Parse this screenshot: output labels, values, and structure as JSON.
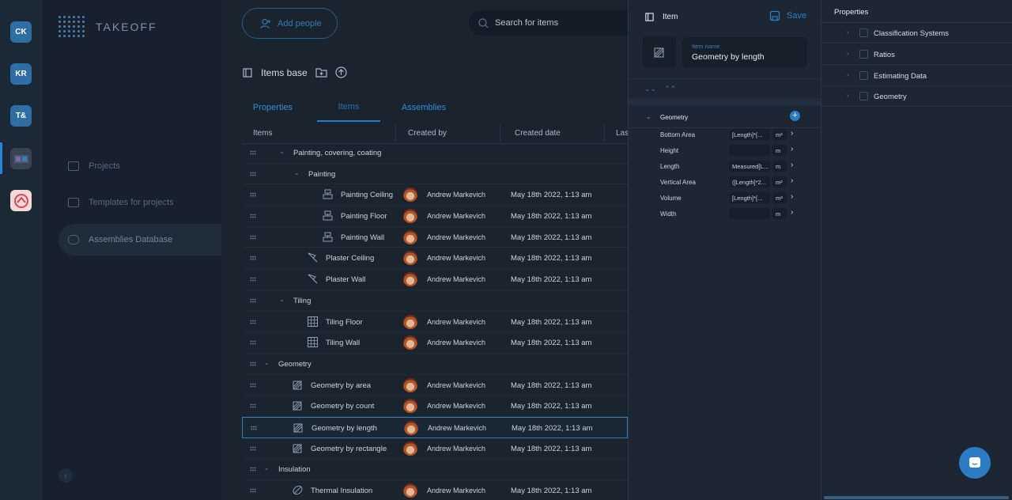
{
  "app": {
    "logo": "TAKEOFF"
  },
  "workspaces": [
    {
      "initials": "CK"
    },
    {
      "initials": "KR"
    },
    {
      "initials": "T&"
    }
  ],
  "sidebar": {
    "items": [
      {
        "label": "Projects"
      },
      {
        "label": "Templates for projects"
      },
      {
        "label": "Assemblies Database"
      }
    ]
  },
  "toolbar": {
    "add_people": "Add people",
    "search_placeholder": "Search for items"
  },
  "items_base": {
    "title": "Items base"
  },
  "tabs": [
    {
      "label": "Properties"
    },
    {
      "label": "Items"
    },
    {
      "label": "Assemblies"
    }
  ],
  "columns": [
    "Items",
    "Created by",
    "Created date",
    "Las"
  ],
  "rows": [
    {
      "name": "Painting, covering, coating",
      "group": true,
      "indent": 1
    },
    {
      "name": "Painting",
      "group": true,
      "indent": 2
    },
    {
      "name": "Painting Ceiling",
      "author": "Andrew Markevich",
      "date": "May 18th 2022, 1:13 am",
      "icon": "paint",
      "indent": 3
    },
    {
      "name": "Painting Floor",
      "author": "Andrew Markevich",
      "date": "May 18th 2022, 1:13 am",
      "icon": "paint",
      "indent": 3
    },
    {
      "name": "Painting Wall",
      "author": "Andrew Markevich",
      "date": "May 18th 2022, 1:13 am",
      "icon": "paint",
      "indent": 3
    },
    {
      "name": "Plaster Ceiling",
      "author": "Andrew Markevich",
      "date": "May 18th 2022, 1:13 am",
      "icon": "trowel",
      "indent": 2
    },
    {
      "name": "Plaster Wall",
      "author": "Andrew Markevich",
      "date": "May 18th 2022, 1:13 am",
      "icon": "trowel",
      "indent": 2
    },
    {
      "name": "Tiling",
      "group": true,
      "indent": 1
    },
    {
      "name": "Tiling Floor",
      "author": "Andrew Markevich",
      "date": "May 18th 2022, 1:13 am",
      "icon": "tile",
      "indent": 2
    },
    {
      "name": "Tiling Wall",
      "author": "Andrew Markevich",
      "date": "May 18th 2022, 1:13 am",
      "icon": "tile",
      "indent": 2
    },
    {
      "name": "Geometry",
      "group": true,
      "indent": 0
    },
    {
      "name": "Geometry by area",
      "author": "Andrew Markevich",
      "date": "May 18th 2022, 1:13 am",
      "icon": "geometry",
      "indent": 1
    },
    {
      "name": "Geometry by count",
      "author": "Andrew Markevich",
      "date": "May 18th 2022, 1:13 am",
      "icon": "geometry",
      "indent": 1
    },
    {
      "name": "Geometry by length",
      "author": "Andrew Markevich",
      "date": "May 18th 2022, 1:13 am",
      "icon": "geometry",
      "indent": 1,
      "selected": true
    },
    {
      "name": "Geometry by rectangle",
      "author": "Andrew Markevich",
      "date": "May 18th 2022, 1:13 am",
      "icon": "geometry",
      "indent": 1
    },
    {
      "name": "Insulation",
      "group": true,
      "indent": 0
    },
    {
      "name": "Thermal Insulation",
      "author": "Andrew Markevich",
      "date": "May 18th 2022, 1:13 am",
      "icon": "leaf",
      "indent": 1
    }
  ],
  "item_panel": {
    "title": "Item",
    "save": "Save",
    "name_label": "Item name",
    "name_value": "Geometry by length",
    "section": "Geometry",
    "properties": [
      {
        "name": "Bottom Area",
        "value": "[Length]*[...",
        "unit": "m²"
      },
      {
        "name": "Height",
        "value": "",
        "unit": "m"
      },
      {
        "name": "Length",
        "value": "Measured[L...",
        "unit": "m"
      },
      {
        "name": "Vertical Area",
        "value": "([Length]*2...",
        "unit": "m²"
      },
      {
        "name": "Volume",
        "value": "[Length]*[...",
        "unit": "m³"
      },
      {
        "name": "Width",
        "value": "",
        "unit": "m"
      }
    ]
  },
  "properties_panel": {
    "title": "Properties",
    "items": [
      {
        "label": "Classification Systems"
      },
      {
        "label": "Ratios"
      },
      {
        "label": "Estimating Data"
      },
      {
        "label": "Geometry"
      }
    ]
  }
}
